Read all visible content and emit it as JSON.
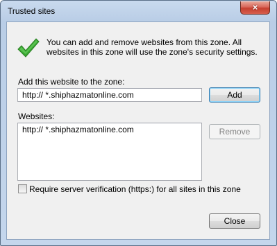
{
  "window": {
    "title": "Trusted sites",
    "close_glyph": "×"
  },
  "info": {
    "icon": "check-icon",
    "text": "You can add and remove websites from this zone. All websites in this zone will use the zone's security settings."
  },
  "add_site": {
    "label": "Add this website to the zone:",
    "value": "http:// *.shiphazmatonline.com",
    "add_button": "Add"
  },
  "websites": {
    "label": "Websites:",
    "items": [
      "http:// *.shiphazmatonline.com"
    ],
    "remove_button": "Remove"
  },
  "https_option": {
    "label": "Require server verification (https:) for all sites in this zone",
    "checked": false
  },
  "footer": {
    "close_button": "Close"
  },
  "colors": {
    "check_green": "#3aa832",
    "title_bar": "#b9cde6",
    "close_red": "#c6402f",
    "dialog_bg": "#f0f0f0"
  }
}
